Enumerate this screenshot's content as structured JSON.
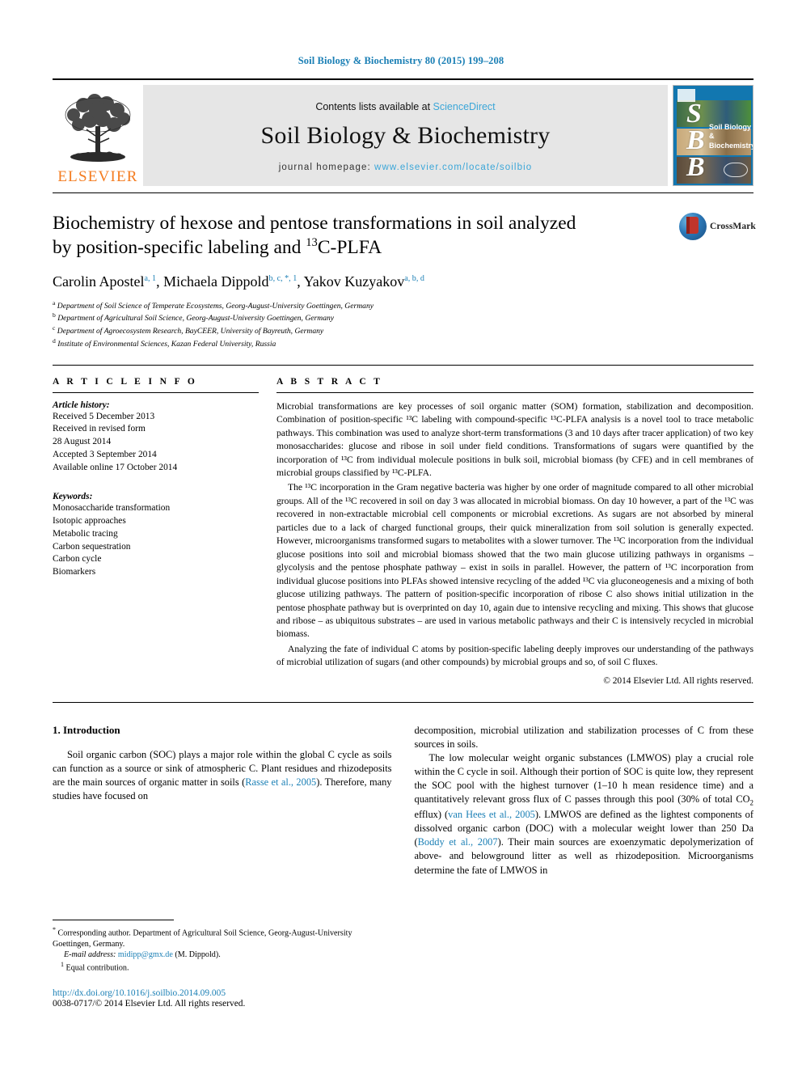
{
  "running_head": "Soil Biology & Biochemistry 80 (2015) 199–208",
  "masthead": {
    "publisher_name": "ELSEVIER",
    "contents_prefix": "Contents lists available at ",
    "contents_link": "ScienceDirect",
    "journal_title": "Soil Biology & Biochemistry",
    "homepage_prefix": "journal homepage: ",
    "homepage_url": "www.elsevier.com/locate/soilbio",
    "cover": {
      "letters": [
        "S",
        "B",
        "B"
      ],
      "title": "Soil Biology & Biochemistry"
    }
  },
  "crossmark": {
    "label": "CrossMark"
  },
  "title": {
    "line1": "Biochemistry of hexose and pentose transformations in soil analyzed",
    "line2_pre": "by position-specific labeling and ",
    "line2_sup": "13",
    "line2_post": "C-PLFA"
  },
  "authors": [
    {
      "name": "Carolin Apostel",
      "marks": "a, 1"
    },
    {
      "name": "Michaela Dippold",
      "marks": "b, c, *, 1"
    },
    {
      "name": "Yakov Kuzyakov",
      "marks": "a, b, d"
    }
  ],
  "affiliations": [
    {
      "mark": "a",
      "text": "Department of Soil Science of Temperate Ecosystems, Georg-August-University Goettingen, Germany"
    },
    {
      "mark": "b",
      "text": "Department of Agricultural Soil Science, Georg-August-University Goettingen, Germany"
    },
    {
      "mark": "c",
      "text": "Department of Agroecosystem Research, BayCEER, University of Bayreuth, Germany"
    },
    {
      "mark": "d",
      "text": "Institute of Environmental Sciences, Kazan Federal University, Russia"
    }
  ],
  "article_info": {
    "heading": "A R T I C L E   I N F O",
    "history_label": "Article history:",
    "history": [
      "Received 5 December 2013",
      "Received in revised form",
      "28 August 2014",
      "Accepted 3 September 2014",
      "Available online 17 October 2014"
    ],
    "keywords_label": "Keywords:",
    "keywords": [
      "Monosaccharide transformation",
      "Isotopic approaches",
      "Metabolic tracing",
      "Carbon sequestration",
      "Carbon cycle",
      "Biomarkers"
    ]
  },
  "abstract": {
    "heading": "A B S T R A C T",
    "paragraphs": [
      "Microbial transformations are key processes of soil organic matter (SOM) formation, stabilization and decomposition. Combination of position-specific ¹³C labeling with compound-specific ¹³C-PLFA analysis is a novel tool to trace metabolic pathways. This combination was used to analyze short-term transformations (3 and 10 days after tracer application) of two key monosaccharides: glucose and ribose in soil under field conditions. Transformations of sugars were quantified by the incorporation of ¹³C from individual molecule positions in bulk soil, microbial biomass (by CFE) and in cell membranes of microbial groups classified by ¹³C-PLFA.",
      "The ¹³C incorporation in the Gram negative bacteria was higher by one order of magnitude compared to all other microbial groups. All of the ¹³C recovered in soil on day 3 was allocated in microbial biomass. On day 10 however, a part of the ¹³C was recovered in non-extractable microbial cell components or microbial excretions. As sugars are not absorbed by mineral particles due to a lack of charged functional groups, their quick mineralization from soil solution is generally expected. However, microorganisms transformed sugars to metabolites with a slower turnover. The ¹³C incorporation from the individual glucose positions into soil and microbial biomass showed that the two main glucose utilizing pathways in organisms – glycolysis and the pentose phosphate pathway – exist in soils in parallel. However, the pattern of ¹³C incorporation from individual glucose positions into PLFAs showed intensive recycling of the added ¹³C via gluconeogenesis and a mixing of both glucose utilizing pathways. The pattern of position-specific incorporation of ribose C also shows initial utilization in the pentose phosphate pathway but is overprinted on day 10, again due to intensive recycling and mixing. This shows that glucose and ribose – as ubiquitous substrates – are used in various metabolic pathways and their C is intensively recycled in microbial biomass.",
      "Analyzing the fate of individual C atoms by position-specific labeling deeply improves our understanding of the pathways of microbial utilization of sugars (and other compounds) by microbial groups and so, of soil C fluxes."
    ],
    "copyright": "© 2014 Elsevier Ltd. All rights reserved."
  },
  "body": {
    "section_number_title": "1. Introduction",
    "left_paragraph_1": "Soil organic carbon (SOC) plays a major role within the global C cycle as soils can function as a source or sink of atmospheric C. Plant residues and rhizodeposits are the main sources of organic matter in soils (",
    "left_cite_1": "Rasse et al., 2005",
    "left_paragraph_1_tail": "). Therefore, many studies have focused on",
    "right_paragraph_1": "decomposition, microbial utilization and stabilization processes of C from these sources in soils.",
    "right_paragraph_2_a": "The low molecular weight organic substances (LMWOS) play a crucial role within the C cycle in soil. Although their portion of SOC is quite low, they represent the SOC pool with the highest turnover (1–10 h mean residence time) and a quantitatively relevant gross flux of C passes through this pool (30% of total CO",
    "right_paragraph_2_sub": "2",
    "right_paragraph_2_b": " efflux) (",
    "right_cite_1": "van Hees et al., 2005",
    "right_paragraph_2_c": "). LMWOS are defined as the lightest components of dissolved organic carbon (DOC) with a molecular weight lower than 250 Da (",
    "right_cite_2": "Boddy et al., 2007",
    "right_paragraph_2_d": "). Their main sources are exoenzymatic depolymerization of above- and belowground litter as well as rhizodeposition. Microorganisms determine the fate of LMWOS in"
  },
  "footnotes": {
    "corresponding_mark": "*",
    "corresponding": "Corresponding author. Department of Agricultural Soil Science, Georg-August-University Goettingen, Germany.",
    "email_label": "E-mail address:",
    "email": "midipp@gmx.de",
    "email_suffix": "(M. Dippold).",
    "equal_mark": "1",
    "equal_contribution": "Equal contribution.",
    "doi": "http://dx.doi.org/10.1016/j.soilbio.2014.09.005",
    "issn": "0038-0717/© 2014 Elsevier Ltd. All rights reserved."
  },
  "colors": {
    "link_blue": "#1a7fb5",
    "sciencedirect_blue": "#3ba6d8",
    "elsevier_orange": "#F47C20",
    "masthead_grey": "#e6e6e6",
    "cover_blue": "#1277b0"
  }
}
